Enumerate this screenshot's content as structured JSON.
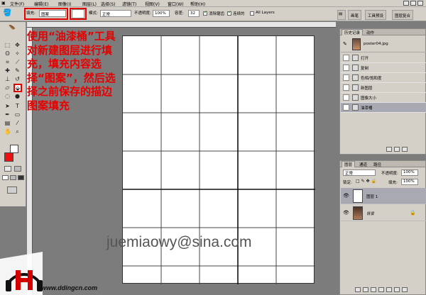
{
  "menu": [
    "文件(F)",
    "编辑(E)",
    "图像(I)",
    "图层(L)",
    "选择(S)",
    "滤镜(T)",
    "视图(V)",
    "窗口(W)",
    "帮助(H)"
  ],
  "options": {
    "fill_label": "填充:",
    "fill_value": "图案",
    "mode_label": "模式:",
    "mode_value": "正常",
    "opacity_label": "不透明度:",
    "opacity_value": "100%",
    "tolerance_label": "容差:",
    "tolerance_value": "32",
    "antialias_label": "消除锯齿",
    "contiguous_label": "连续的",
    "all_layers_label": "All Layers",
    "right_tabs": [
      "画笔",
      "工具预设",
      "图层复合"
    ]
  },
  "annotation": "使用“油漆桶”工具对新建图层进行填充，填充内容选择“图案”，然后选择之前保存的描边图案填充",
  "watermark_email": "juemiaowy@sina.com",
  "logo": {
    "site": "www.ddingcn.com"
  },
  "history_panel": {
    "tabs": [
      "历史记录",
      "动作"
    ],
    "snapshot": "poster04.jpg",
    "items": [
      "打开",
      "复制",
      "色相/饱和度",
      "新图层",
      "图像大小",
      "油漆桶"
    ]
  },
  "layers_panel": {
    "tabs": [
      "图层",
      "通道",
      "路径"
    ],
    "mode": "正常",
    "opacity_label": "不透明度:",
    "opacity_value": "100%",
    "lock_label": "锁定:",
    "fill_label": "填充:",
    "fill_value": "100%",
    "layers": [
      "图层 1",
      "背景"
    ]
  },
  "colors": {
    "accent_red": "#e80000",
    "panel_bg": "#d4d0c8",
    "workspace": "#7c7c7c"
  }
}
